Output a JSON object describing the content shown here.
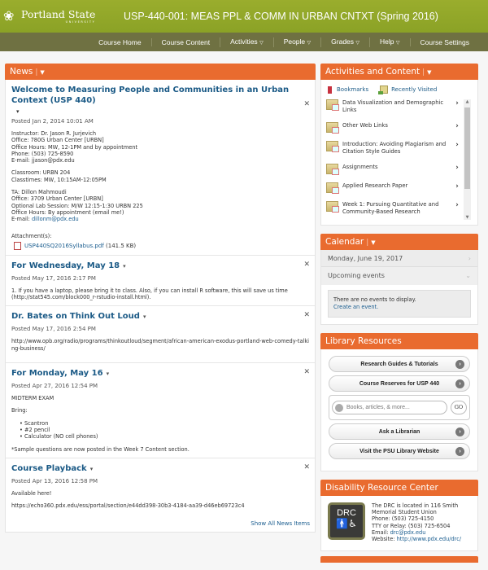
{
  "header": {
    "logo_text": "Portland State",
    "logo_sub": "UNIVERSITY",
    "course_title": "USP-440-001: MEAS PPL & COMM IN URBAN CNTXT (Spring 2016)"
  },
  "nav": [
    {
      "label": "Course Home",
      "dropdown": false
    },
    {
      "label": "Course Content",
      "dropdown": false
    },
    {
      "label": "Activities",
      "dropdown": true
    },
    {
      "label": "People",
      "dropdown": true
    },
    {
      "label": "Grades",
      "dropdown": true
    },
    {
      "label": "Help",
      "dropdown": true
    },
    {
      "label": "Course Settings",
      "dropdown": false
    }
  ],
  "news": {
    "title": "News",
    "items": [
      {
        "title": "Welcome to Measuring People and Communities in an Urban Context (USP 440)",
        "posted": "Posted Jan 2, 2014 10:01 AM",
        "instructor": [
          "Instructor:  Dr. Jason R. Jurjevich",
          "Office:  780G Urban Center [URBN]",
          "Office Hours:  MW, 12-1PM and by appointment",
          "Phone:  (503) 725-8590",
          "E-mail:  jjason@pdx.edu"
        ],
        "classroom": [
          "Classroom:  URBN 204",
          "Classtimes:  MW, 10:15AM-12:05PM"
        ],
        "ta": [
          "TA: Dillon Mahmoudi",
          "Office: 3709 Urban Center [URBN]",
          "Optional Lab Session: M/W 12:15-1:30 URBN 225",
          "Office Hours: By appointment (email me!)"
        ],
        "ta_email_label": "E-mail: ",
        "ta_email": "dillonm@pdx.edu",
        "attachments_label": "Attachment(s):",
        "attachment_name": "USP440SQ2016Syllabus.pdf",
        "attachment_size": "(141.5 KB)"
      },
      {
        "title": "For Wednesday, May 18",
        "posted": "Posted May 17, 2016 2:17 PM",
        "body": "1.  If you have a laptop, please bring it to class.  Also, if you can install R software, this will save us time (http://stat545.com/block000_r-rstudio-install.html)."
      },
      {
        "title": "Dr. Bates on Think Out Loud",
        "posted": "Posted May 17, 2016 2:54 PM",
        "link": "http://www.opb.org/radio/programs/thinkoutloud/segment/african-american-exodus-portland-web-comedy-talking-business/"
      },
      {
        "title": "For Monday, May 16",
        "posted": "Posted Apr 27, 2016 12:54 PM",
        "line1": "MIDTERM EXAM",
        "line2": "Bring:",
        "bullets": [
          "Scantron",
          "#2 pencil",
          "Calculator (NO cell phones)"
        ],
        "note": "*Sample questions are now posted in the Week 7 Content section."
      },
      {
        "title": "Course Playback",
        "posted": "Posted Apr 13, 2016 12:58 PM",
        "line1": "Available here!",
        "link": "https://echo360.pdx.edu/ess/portal/section/e44dd398-30b3-4184-aa39-d46eb69723c4"
      }
    ],
    "show_all": "Show All News Items"
  },
  "activities": {
    "title": "Activities and Content",
    "bookmarks": "Bookmarks",
    "recently_visited": "Recently Visited",
    "items": [
      "Data Visualization and Demographic Links",
      "Other Web Links",
      "Introduction: Avoiding Plagiarism and Citation Style Guides",
      "Assignments",
      "Applied Research Paper",
      "Week 1: Pursuing Quantitative and Community-Based Research"
    ]
  },
  "calendar": {
    "title": "Calendar",
    "date": "Monday, June 19, 2017",
    "upcoming": "Upcoming events",
    "empty": "There are no events to display.",
    "create": "Create an event."
  },
  "library": {
    "title": "Library Resources",
    "buttons": [
      "Research Guides & Tutorials",
      "Course Reserves for USP 440",
      "Ask a Librarian",
      "Visit the PSU Library Website"
    ],
    "search_placeholder": "Books, articles, & more...",
    "go": "GO"
  },
  "drc": {
    "title": "Disability Resource Center",
    "logo": "DRC",
    "lines": [
      "The DRC is located in 116 Smith",
      "Memorial Student Union",
      "Phone: (503) 725-4150",
      "TTY or Relay: (503) 725-6504"
    ],
    "email_label": "Email: ",
    "email": "drc@pdx.edu",
    "website_label": "Website: ",
    "website": "http://www.pdx.edu/drc/"
  }
}
